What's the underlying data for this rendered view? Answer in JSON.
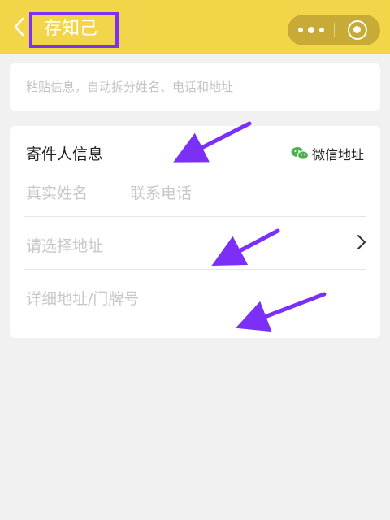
{
  "header": {
    "title": "存知己",
    "background": "#f3d54a",
    "highlight_color": "#7b2ff7"
  },
  "paste": {
    "placeholder": "粘贴信息，自动拆分姓名、电话和地址"
  },
  "sender": {
    "section_title": "寄件人信息",
    "wechat_address": "微信地址",
    "name_placeholder": "真实姓名",
    "phone_placeholder": "联系电话",
    "region_placeholder": "请选择地址",
    "detail_placeholder": "详细地址/门牌号"
  },
  "icons": [
    "back-icon",
    "more-icon",
    "close-icon",
    "wechat-icon",
    "chevron-right-icon"
  ],
  "colors": {
    "arrow": "#7b2ff7",
    "wechat_green": "#4caf50"
  }
}
